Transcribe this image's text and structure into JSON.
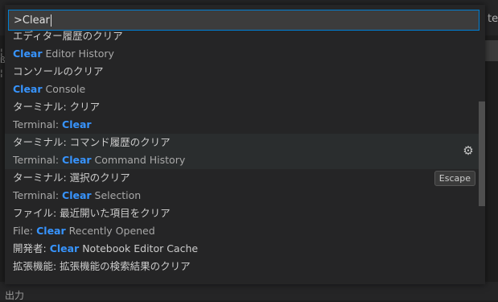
{
  "background": {
    "right_text": "te",
    "left_glyphs": [
      "¦",
      "ß",
      "¦"
    ],
    "bottom_text": "出力"
  },
  "quick_input": {
    "value": ">Clear",
    "items": [
      {
        "label": "エディター履歴のクリア",
        "desc_pre": "",
        "desc_hl": "Clear",
        "desc_post": " Editor History"
      },
      {
        "label": "コンソールのクリア",
        "desc_pre": "",
        "desc_hl": "Clear",
        "desc_post": " Console"
      },
      {
        "label": "ターミナル: クリア",
        "desc_pre": "Terminal: ",
        "desc_hl": "Clear",
        "desc_post": ""
      },
      {
        "label": "ターミナル: コマンド履歴のクリア",
        "desc_pre": "Terminal: ",
        "desc_hl": "Clear",
        "desc_post": " Command History"
      },
      {
        "label": "ターミナル: 選択のクリア",
        "desc_pre": "Terminal: ",
        "desc_hl": "Clear",
        "desc_post": " Selection",
        "keybinding": "Escape"
      },
      {
        "label": "ファイル: 最近開いた項目をクリア",
        "desc_pre": "File: ",
        "desc_hl": "Clear",
        "desc_post": " Recently Opened"
      },
      {
        "label_pre": "開発者: ",
        "label_hl": "Clear",
        "label_post": " Notebook Editor Cache"
      },
      {
        "label": "拡張機能: 拡張機能の検索結果のクリア"
      }
    ],
    "selected_index": 3,
    "gear_icon": "gear-icon"
  }
}
